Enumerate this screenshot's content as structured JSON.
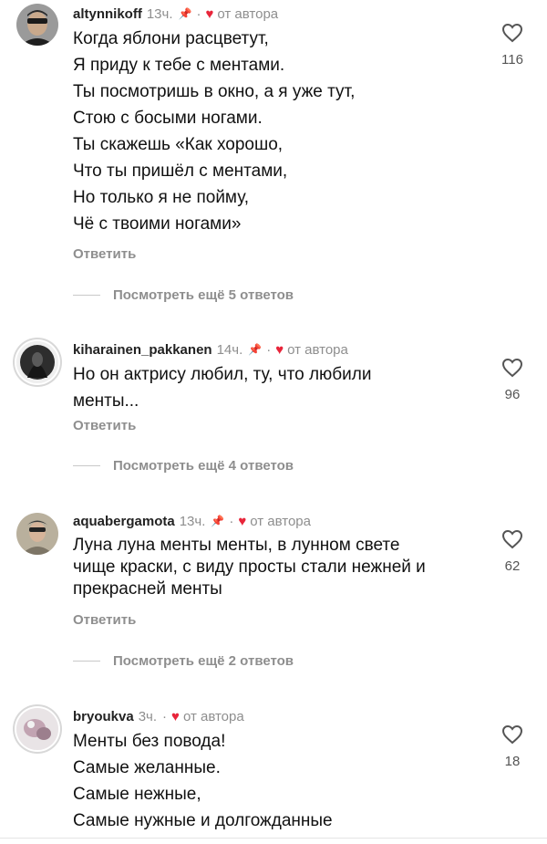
{
  "comments": [
    {
      "username": "altynnikoff",
      "time": "13ч.",
      "author_like": "от автора",
      "lines": [
        "Когда яблони расцветут,",
        "Я приду к тебе с ментами.",
        "Ты посмотришь в окно, а я уже тут,",
        "Стою с босыми ногами.",
        "Ты скажешь «Как хорошо,",
        "Что ты пришёл с ментами,",
        "Но только я не пойму,",
        "Чё с твоими ногами»"
      ],
      "likes": "116",
      "reply_label": "Ответить",
      "more_label": "Посмотреть ещё 5 ответов"
    },
    {
      "username": "kiharainen_pakkanen",
      "time": "14ч.",
      "author_like": "от автора",
      "lines": [
        "Но он актрису любил, ту, что любили",
        "менты..."
      ],
      "likes": "96",
      "reply_label": "Ответить",
      "more_label": "Посмотреть ещё 4 ответов"
    },
    {
      "username": "aquabergamota",
      "time": "13ч.",
      "author_like": "от автора",
      "lines": [
        "Луна луна менты менты,  в лунном свете",
        "чище краски, с виду просты  стали нежней и",
        "прекрасней менты"
      ],
      "likes": "62",
      "reply_label": "Ответить",
      "more_label": "Посмотреть ещё 2 ответов"
    },
    {
      "username": "bryoukva",
      "time": "3ч.",
      "author_like": "от автора",
      "lines": [
        "Менты без повода!",
        "Самые желанные.",
        "Самые нежные,",
        "Самые нужные и долгожданные"
      ],
      "likes": "18"
    }
  ],
  "colors": {
    "heart": "#e8253a",
    "muted": "#8e8e8e",
    "text": "#111111"
  },
  "icons": {
    "pin": "pin-icon",
    "heart": "heart-icon",
    "like": "heart-outline-icon"
  }
}
